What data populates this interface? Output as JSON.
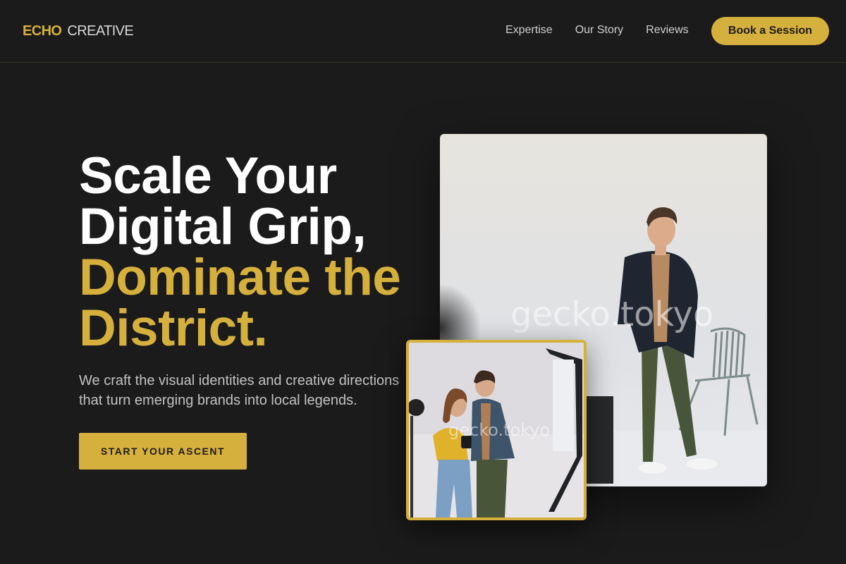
{
  "logo": {
    "part1": "ECHO",
    "part2": "CREATIVE"
  },
  "nav": {
    "links": [
      "Expertise",
      "Our Story",
      "Reviews"
    ],
    "cta": "Book a Session"
  },
  "hero": {
    "headline_line1": "Scale Your",
    "headline_line2": "Digital Grip,",
    "headline_line3": "Dominate the",
    "headline_line4": "District.",
    "subtext": "We craft the visual identities and creative directions that turn emerging brands into local legends.",
    "cta": "START YOUR ASCENT"
  },
  "images": {
    "main_watermark": "gecko.tokyo",
    "sub_watermark": "gecko.tokyo"
  },
  "colors": {
    "background": "#1b1b1b",
    "accent": "#d6b03d",
    "text_light": "#ffffff",
    "text_muted": "#c2c2c2"
  }
}
